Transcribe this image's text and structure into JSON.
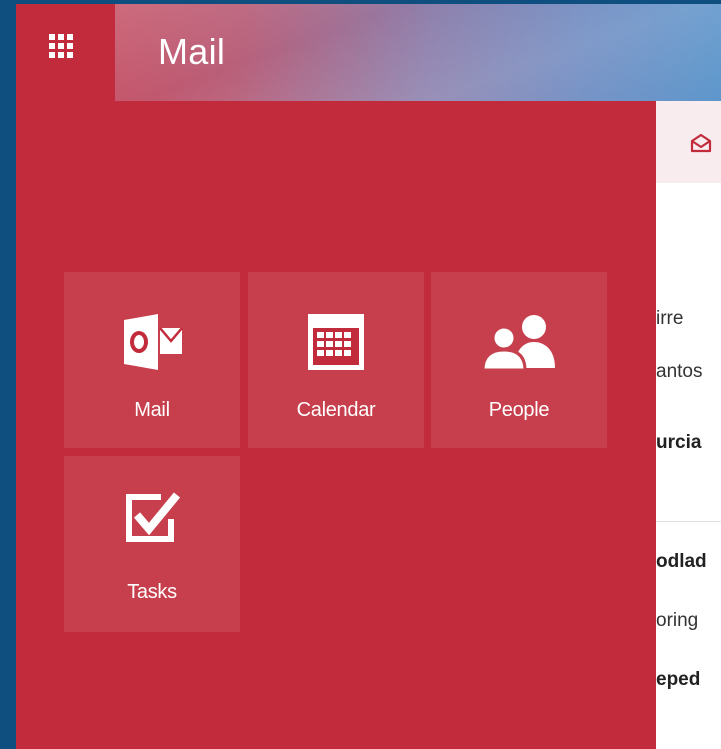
{
  "header": {
    "app_title": "Mail",
    "waffle_icon": "app-launcher-icon"
  },
  "launcher": {
    "tiles": [
      {
        "label": "Mail",
        "icon": "outlook-mail-icon"
      },
      {
        "label": "Calendar",
        "icon": "calendar-icon"
      },
      {
        "label": "People",
        "icon": "people-icon"
      },
      {
        "label": "Tasks",
        "icon": "tasks-checkbox-icon"
      }
    ]
  },
  "reading_pane": {
    "toolbar_icon": "envelope-open-icon",
    "fragments": [
      "irre",
      "antos",
      "urcia",
      "odlad",
      "oring",
      "eped"
    ]
  },
  "colors": {
    "launcher_bg": "#c22b3b",
    "frame_bg": "#0e4f7f",
    "text_on_accent": "#ffffff"
  }
}
